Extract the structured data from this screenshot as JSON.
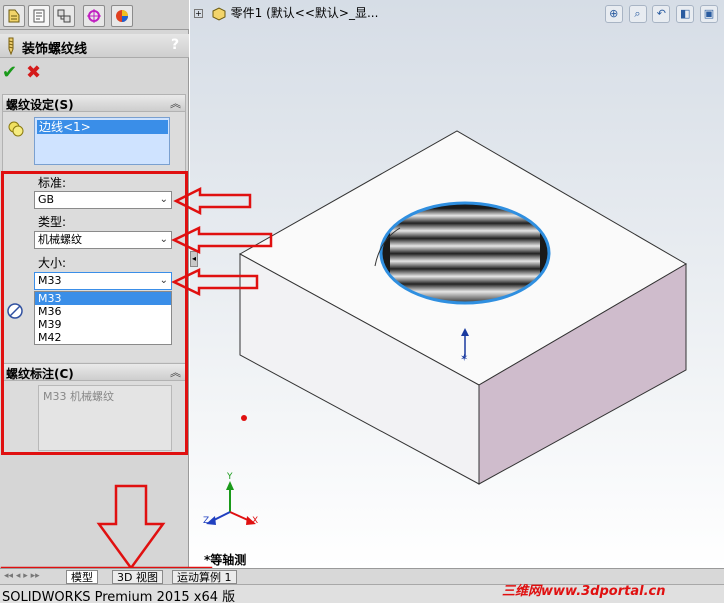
{
  "panel": {
    "tabs": [
      "feature-manager-icon",
      "property-manager-icon",
      "configuration-manager-icon",
      "dimxpert-icon",
      "display-manager-icon"
    ],
    "title": "装饰螺纹线",
    "help": "?"
  },
  "thread_settings": {
    "header": "螺纹设定(S)",
    "edge_item": "边线<1>",
    "standard_label": "标准:",
    "standard_value": "GB",
    "type_label": "类型:",
    "type_value": "机械螺纹",
    "size_label": "大小:",
    "size_value": "M33",
    "size_options": [
      "M33",
      "M36",
      "M39",
      "M42"
    ],
    "selected_option": "M33"
  },
  "thread_callout": {
    "header": "螺纹标注(C)",
    "text": "M33 机械螺纹"
  },
  "graphics": {
    "tree_path": "零件1  (默认<<默认>_显...",
    "view_name": "*等轴测",
    "triad": {
      "x": "X",
      "y": "Y",
      "z": "Z"
    }
  },
  "bottom_tabs": [
    "模型",
    "3D 视图",
    "运动算例 1"
  ],
  "status": "SOLIDWORKS Premium 2015 x64 版",
  "watermark": "三维网www.3dportal.cn",
  "colors": {
    "annotation_red": "#e01010",
    "selection_blue": "#3a8ee8",
    "ok_green": "#1a9a1a"
  }
}
